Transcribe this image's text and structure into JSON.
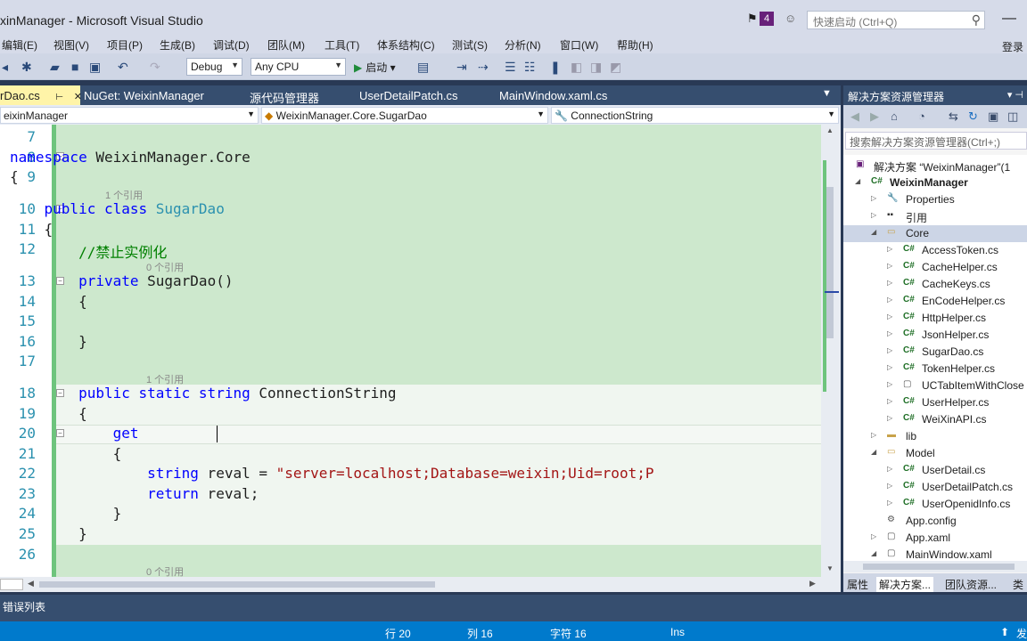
{
  "window": {
    "title": "xinManager - Microsoft Visual Studio",
    "notification_count": "4",
    "quick_launch_placeholder": "快速启动 (Ctrl+Q)",
    "login_label": "登录"
  },
  "menu": [
    "编辑(E)",
    "视图(V)",
    "项目(P)",
    "生成(B)",
    "调试(D)",
    "团队(M)",
    "工具(T)",
    "体系结构(C)",
    "测试(S)",
    "分析(N)",
    "窗口(W)",
    "帮助(H)"
  ],
  "toolbar": {
    "config": "Debug",
    "platform": "Any CPU",
    "start_label": "启动"
  },
  "tabs": [
    {
      "label": "rDao.cs"
    },
    {
      "label": "NuGet: WeixinManager"
    },
    {
      "label": "源代码管理器"
    },
    {
      "label": "UserDetailPatch.cs"
    },
    {
      "label": "MainWindow.xaml.cs"
    }
  ],
  "navbar": {
    "project": "eixinManager",
    "type": "WeixinManager.Core.SugarDao",
    "member": "ConnectionString"
  },
  "editor": {
    "line_numbers": [
      "7",
      "8",
      "9",
      "10",
      "11",
      "12",
      "13",
      "14",
      "15",
      "16",
      "17",
      "18",
      "19",
      "20",
      "21",
      "22",
      "23",
      "24",
      "25",
      "26"
    ],
    "lens": {
      "class_refs": "1 个引用",
      "ctor_refs": "0 个引用",
      "prop_refs": "1 个引用",
      "next_refs": "0 个引用"
    },
    "code": {
      "l8_kw": "namespace",
      "l8_name": " WeixinManager.Core",
      "l9": "{",
      "l10_kw": "    public class",
      "l10_ty": " SugarDao",
      "l11": "    {",
      "l12_cm": "        //禁止实例化",
      "l13_kw": "        private",
      "l13_rest": " SugarDao()",
      "l14": "        {",
      "l16": "        }",
      "l18_kw": "        public static string",
      "l18_rest": " ConnectionString",
      "l19": "        {",
      "l20_kw": "            get",
      "l21": "            {",
      "l22_kw": "                string",
      "l22_mid": " reval = ",
      "l22_st": "\"server=localhost;Database=weixin;Uid=root;P",
      "l23_kw": "                return",
      "l23_rest": " reval;",
      "l24": "            }",
      "l25": "        }"
    }
  },
  "solution": {
    "panel_title": "解决方案资源管理器",
    "search_placeholder": "搜索解决方案资源管理器(Ctrl+;)",
    "items": [
      {
        "label": "解决方案 “WeixinManager”(1"
      },
      {
        "label": "WeixinManager"
      },
      {
        "label": "Properties"
      },
      {
        "label": "引用"
      },
      {
        "label": "Core"
      },
      {
        "label": "AccessToken.cs"
      },
      {
        "label": "CacheHelper.cs"
      },
      {
        "label": "CacheKeys.cs"
      },
      {
        "label": "EnCodeHelper.cs"
      },
      {
        "label": "HttpHelper.cs"
      },
      {
        "label": "JsonHelper.cs"
      },
      {
        "label": "SugarDao.cs"
      },
      {
        "label": "TokenHelper.cs"
      },
      {
        "label": "UCTabItemWithClose"
      },
      {
        "label": "UserHelper.cs"
      },
      {
        "label": "WeiXinAPI.cs"
      },
      {
        "label": "lib"
      },
      {
        "label": "Model"
      },
      {
        "label": "UserDetail.cs"
      },
      {
        "label": "UserDetailPatch.cs"
      },
      {
        "label": "UserOpenidInfo.cs"
      },
      {
        "label": "App.config"
      },
      {
        "label": "App.xaml"
      },
      {
        "label": "MainWindow.xaml"
      }
    ],
    "bottom_tabs": [
      "属性",
      "解决方案...",
      "团队资源...",
      "类"
    ]
  },
  "error_list_tab": "错误列表",
  "status": {
    "row": "行 20",
    "col": "列 16",
    "char": "字符 16",
    "mode": "Ins",
    "publish": "发"
  }
}
